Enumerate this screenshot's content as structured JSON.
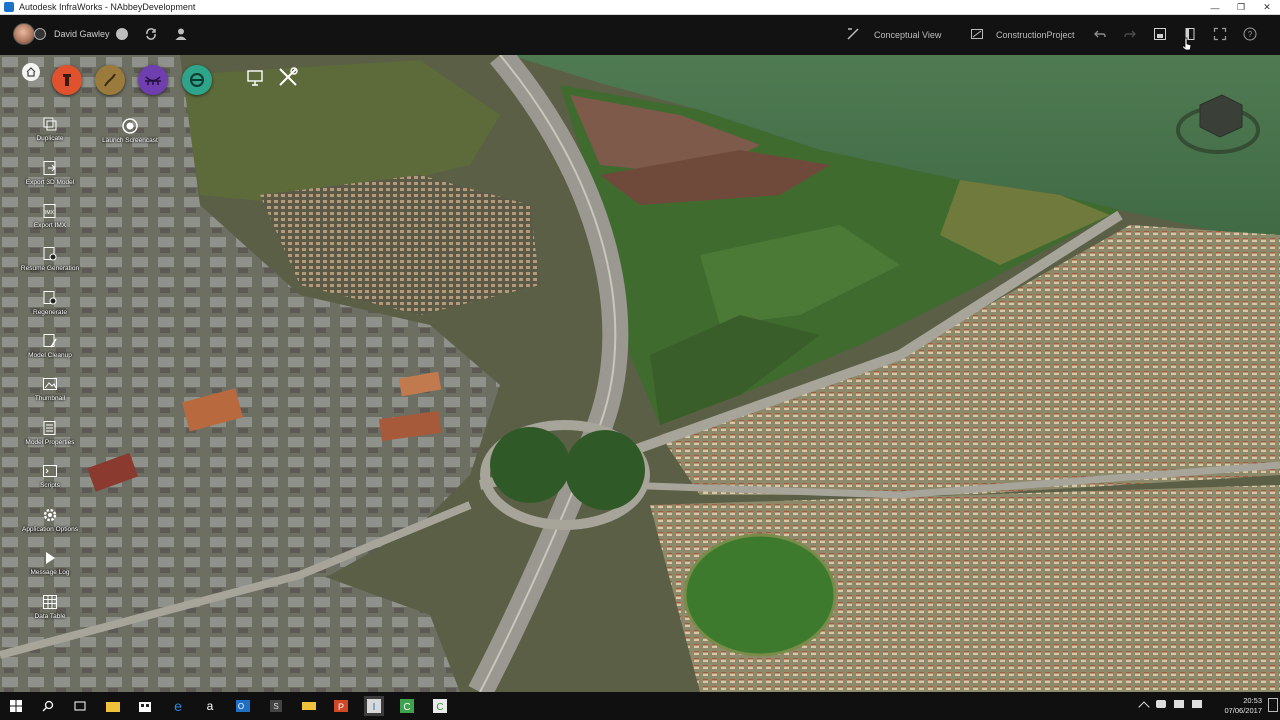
{
  "window": {
    "title": "Autodesk InfraWorks - NAbbeyDevelopment",
    "controls": [
      "minimize",
      "restore",
      "close"
    ]
  },
  "topbar": {
    "user_name": "David Gawley",
    "left_icons": [
      "notification-icon",
      "sync-icon",
      "person-icon"
    ],
    "conceptual_view_label": "Conceptual View",
    "project_label": "ConstructionProject",
    "right_icons": [
      "undo-icon",
      "redo-icon",
      "save-icon",
      "bookmark-icon",
      "expand-icon",
      "help-icon"
    ]
  },
  "tool_circles": [
    {
      "name": "build-manage-analyze-icon",
      "color": "#e0522e"
    },
    {
      "name": "roads-icon",
      "color": "#9a7b3c"
    },
    {
      "name": "bridges-icon",
      "color": "#6f3fb0"
    },
    {
      "name": "drainage-icon",
      "color": "#2ea58a"
    }
  ],
  "side_tools": [
    {
      "label": "Duplicate",
      "icon": "duplicate-icon"
    },
    {
      "label": "Launch Screencast",
      "icon": "screencast-icon"
    },
    {
      "label": "Export 3D Model",
      "icon": "export-3d-model-icon"
    },
    {
      "label": "Export IMX",
      "icon": "export-imx-icon"
    },
    {
      "label": "Resume Generation",
      "icon": "resume-generation-icon"
    },
    {
      "label": "Regenerate",
      "icon": "regenerate-icon"
    },
    {
      "label": "Model Cleanup",
      "icon": "model-cleanup-icon"
    },
    {
      "label": "Thumbnail",
      "icon": "thumbnail-icon"
    },
    {
      "label": "Model Properties",
      "icon": "model-properties-icon"
    },
    {
      "label": "Scripts",
      "icon": "scripts-icon"
    },
    {
      "label": "Application Options",
      "icon": "application-options-icon"
    },
    {
      "label": "Message Log",
      "icon": "message-log-icon"
    },
    {
      "label": "Data Table",
      "icon": "data-table-icon"
    }
  ],
  "taskbar": {
    "apps": [
      "start-icon",
      "search-icon",
      "task-view-icon",
      "file-explorer-icon",
      "store-icon",
      "edge-icon",
      "amazon-icon",
      "outlook-icon",
      "sublime-icon",
      "onedrive-icon",
      "powerpoint-icon",
      "infraworks-icon",
      "civil3d-icon",
      "camtasia-icon"
    ],
    "time": "20:53",
    "date": "07/06/2017"
  },
  "colors": {
    "sea": "#4a6e47",
    "fields": "#3f6b2f",
    "industrial": "#7a7a72",
    "housing": "#b9a384"
  }
}
